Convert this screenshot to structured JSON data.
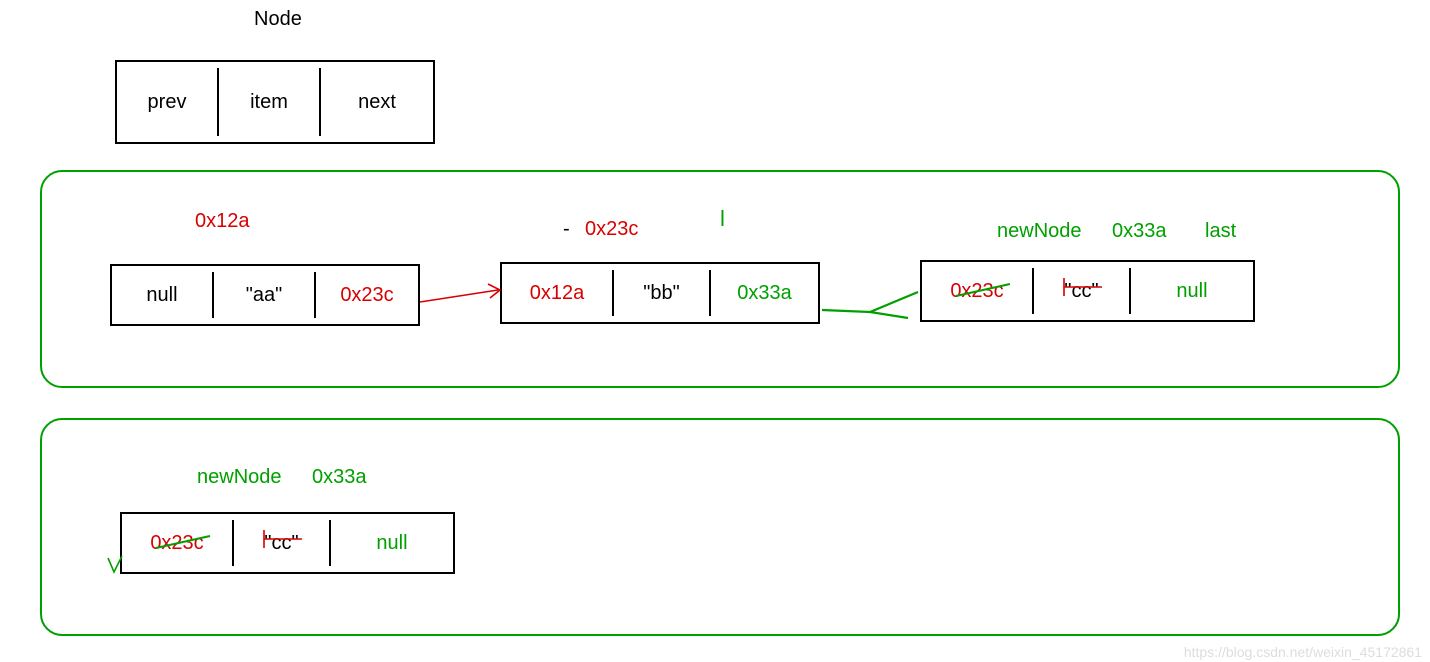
{
  "legend": {
    "title": "Node",
    "cells": {
      "prev": "prev",
      "item": "item",
      "next": "next"
    }
  },
  "panel1": {
    "node1": {
      "addr": "0x12a",
      "prev": "null",
      "item": "\"aa\"",
      "next": "0x23c"
    },
    "node2": {
      "addr": "0x23c",
      "dash": "-",
      "lLabel": "l",
      "prev": "0x12a",
      "item": "\"bb\"",
      "next": "0x33a"
    },
    "node3": {
      "newNodeLabel": "newNode",
      "addr": "0x33a",
      "lastLabel": "last",
      "prev": "0x23c",
      "item": "\"cc\"",
      "next": "null"
    }
  },
  "panel2": {
    "node": {
      "newNodeLabel": "newNode",
      "addr": "0x33a",
      "prev": "0x23c",
      "item": "\"cc\"",
      "next": "null"
    }
  },
  "watermark": "https://blog.csdn.net/weixin_45172861"
}
